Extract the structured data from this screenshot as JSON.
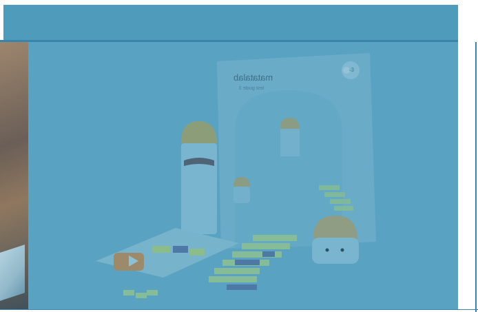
{
  "slide": {
    "brand_text": "matatalab",
    "box_subtitle": "test guide 3",
    "box_badge": "-3"
  },
  "colors": {
    "overlay": "#5aa2c2",
    "band": "#4e9bbb",
    "rule": "#3a84ac"
  }
}
